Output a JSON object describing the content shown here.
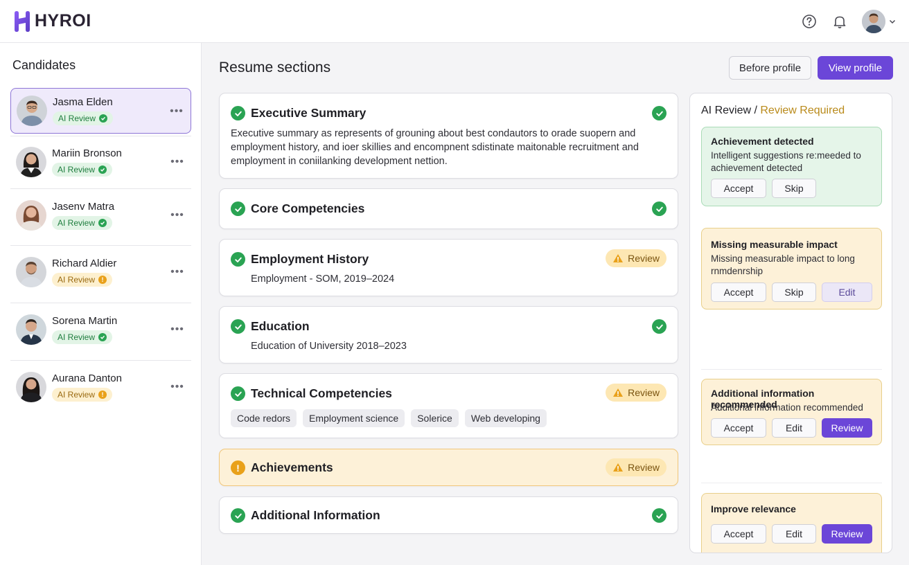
{
  "app": {
    "name": "HYROI",
    "brand_color": "#6b46d8"
  },
  "header": {
    "icons": [
      "help-icon",
      "bell-icon",
      "user-avatar",
      "chevron-down-icon"
    ]
  },
  "sidebar": {
    "title": "Candidates",
    "candidates": [
      {
        "name": "Jasma Elden",
        "badge": "AI Review",
        "status": "ok",
        "selected": true
      },
      {
        "name": "Mariin Bronson",
        "badge": "AI Review",
        "status": "ok"
      },
      {
        "name": "Jasenv Matra",
        "badge": "AI Review",
        "status": "ok"
      },
      {
        "name": "Richard Aldier",
        "badge": "AI Review",
        "status": "warn"
      },
      {
        "name": "Sorena Martin",
        "badge": "AI Review",
        "status": "ok"
      },
      {
        "name": "Aurana Danton",
        "badge": "AI Review",
        "status": "warn"
      }
    ]
  },
  "main": {
    "title": "Resume sections",
    "before_label": "Before profile",
    "view_label": "View profile",
    "sections": [
      {
        "title": "Executive Summary",
        "status": "ok",
        "body": "Executive summary as represents of grouning about best condautors to orade suopern and employment history, and ioer skillies and encompnent sdistinate maitonable recruitment and employment in coniilanking development nettion."
      },
      {
        "title": "Core Competencies",
        "status": "ok"
      },
      {
        "title": "Employment History",
        "status": "review",
        "review_label": "Review",
        "body": "Employment - SOM, 2019–2024"
      },
      {
        "title": "Education",
        "status": "ok",
        "body": "Education of University 2018–2023"
      },
      {
        "title": "Technical Competencies",
        "status": "review",
        "review_label": "Review",
        "chips": [
          "Code redors",
          "Employment science",
          "Solerice",
          "Web developing"
        ]
      },
      {
        "title": "Achievements",
        "status": "review",
        "review_label": "Review"
      },
      {
        "title": "Additional Information",
        "status": "ok"
      }
    ]
  },
  "panel": {
    "title_prefix": "AI Review / ",
    "title_highlight": "Review Required",
    "cards": [
      {
        "title": "Achievement detected",
        "desc": " Intelligent suggestions re:meeded to achievement detected",
        "actions": [
          "Accept",
          "Skip"
        ]
      },
      {
        "title": "Missing measurable impact",
        "desc": "Missing measurable impact to long rnmdenrship",
        "actions": [
          "Accept",
          "Skip",
          "Edit"
        ]
      },
      {
        "title": "Additional information recommended",
        "desc": "Additional information recommended",
        "actions": [
          "Accept",
          "Edit",
          "Review"
        ]
      },
      {
        "title": "Improve relevance",
        "desc": "",
        "actions": [
          "Accept",
          "Edit",
          "Review"
        ]
      }
    ]
  }
}
